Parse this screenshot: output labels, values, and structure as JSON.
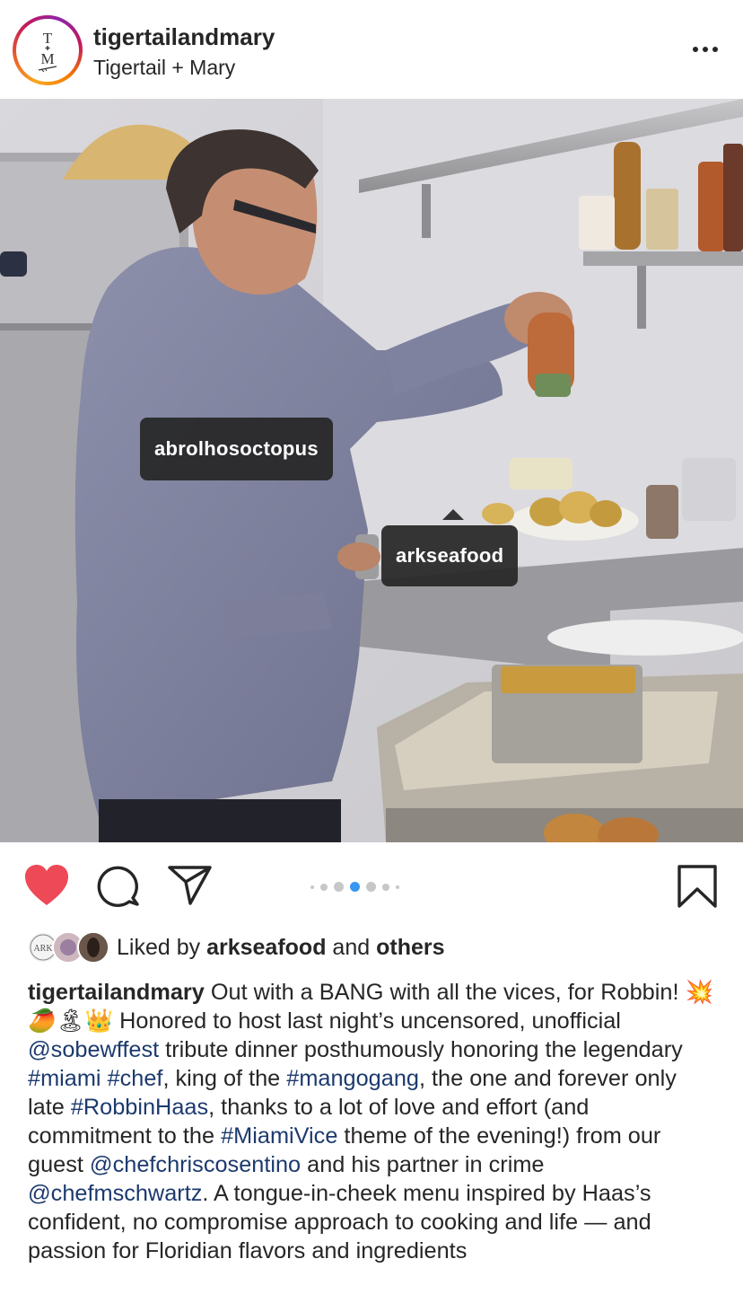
{
  "post": {
    "username": "tigertailandmary",
    "location": "Tigertail + Mary",
    "avatar_monogram_top": "T",
    "avatar_monogram_bottom": "M",
    "more_icon": "ellipsis-icon"
  },
  "photo": {
    "tags": [
      {
        "label": "abrolhosoctopus"
      },
      {
        "label": "arkseafood"
      }
    ],
    "user_tags_icon": "person-icon"
  },
  "actions": {
    "like_icon": "heart-filled-icon",
    "comment_icon": "comment-icon",
    "share_icon": "paper-plane-icon",
    "save_icon": "bookmark-icon",
    "carousel": {
      "total": 7,
      "active_index": 3
    },
    "like_color": "#ed4956",
    "active_dot_color": "#3897f0"
  },
  "likes": {
    "prefix": "Liked by",
    "first_user": "arkseafood",
    "conjunction": "and",
    "others": "others",
    "mini_avatar_label": "ARK"
  },
  "caption": {
    "username": "tigertailandmary",
    "t1": " Out with a BANG with all the vices, for Robbin! 💥🥭🏝👑 Honored to host last night’s uncensored, unofficial ",
    "l1": "@sobewffest",
    "t2": " tribute dinner posthumously honoring the legendary ",
    "l2": "#miami",
    "t3": " ",
    "l3": "#chef",
    "t4": ", king of the ",
    "l4": "#mangogang",
    "t5": ", the one and forever only late ",
    "l5": "#RobbinHaas",
    "t6": ", thanks to a lot of love and effort (and commitment to the ",
    "l6": "#MiamiVice",
    "t7": " theme of the evening!) from our guest ",
    "l7": "@chefchriscosentino",
    "t8": " and his partner in crime ",
    "l8": "@chefmschwartz",
    "t9": ". A tongue-in-cheek menu inspired by Haas’s confident, no compromise approach to cooking and life — and passion for Floridian flavors and ingredients"
  }
}
